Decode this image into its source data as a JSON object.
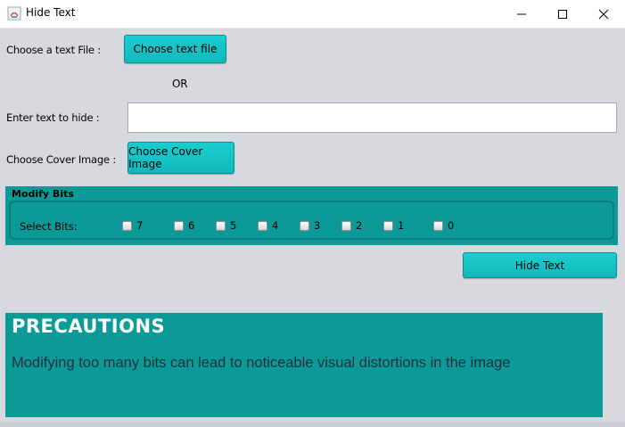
{
  "window": {
    "title": "Hide Text",
    "controls": [
      "minimize-icon",
      "maximize-icon",
      "close-icon"
    ]
  },
  "form": {
    "choose_file_label": "Choose a text File :",
    "choose_file_button": "Choose text file",
    "or_text": "OR",
    "enter_text_label": "Enter text to hide :",
    "enter_text_value": "",
    "cover_image_label": "Choose Cover Image :",
    "cover_image_button": "Choose Cover Image"
  },
  "modify_bits": {
    "title": "Modify Bits",
    "select_label": "Select Bits:",
    "bits": [
      {
        "label": "7",
        "checked": false
      },
      {
        "label": "6",
        "checked": false
      },
      {
        "label": "5",
        "checked": false
      },
      {
        "label": "4",
        "checked": false
      },
      {
        "label": "3",
        "checked": false
      },
      {
        "label": "2",
        "checked": false
      },
      {
        "label": "1",
        "checked": false
      },
      {
        "label": "0",
        "checked": false
      }
    ]
  },
  "hide_button": "Hide Text",
  "precautions": {
    "title": "PRECAUTIONS",
    "text": "Modifying too many bits can lead to noticeable visual distortions in the image"
  },
  "colors": {
    "background": "#d7d9df",
    "accent_button": "#14c3c7",
    "panel": "#0c9a98"
  }
}
